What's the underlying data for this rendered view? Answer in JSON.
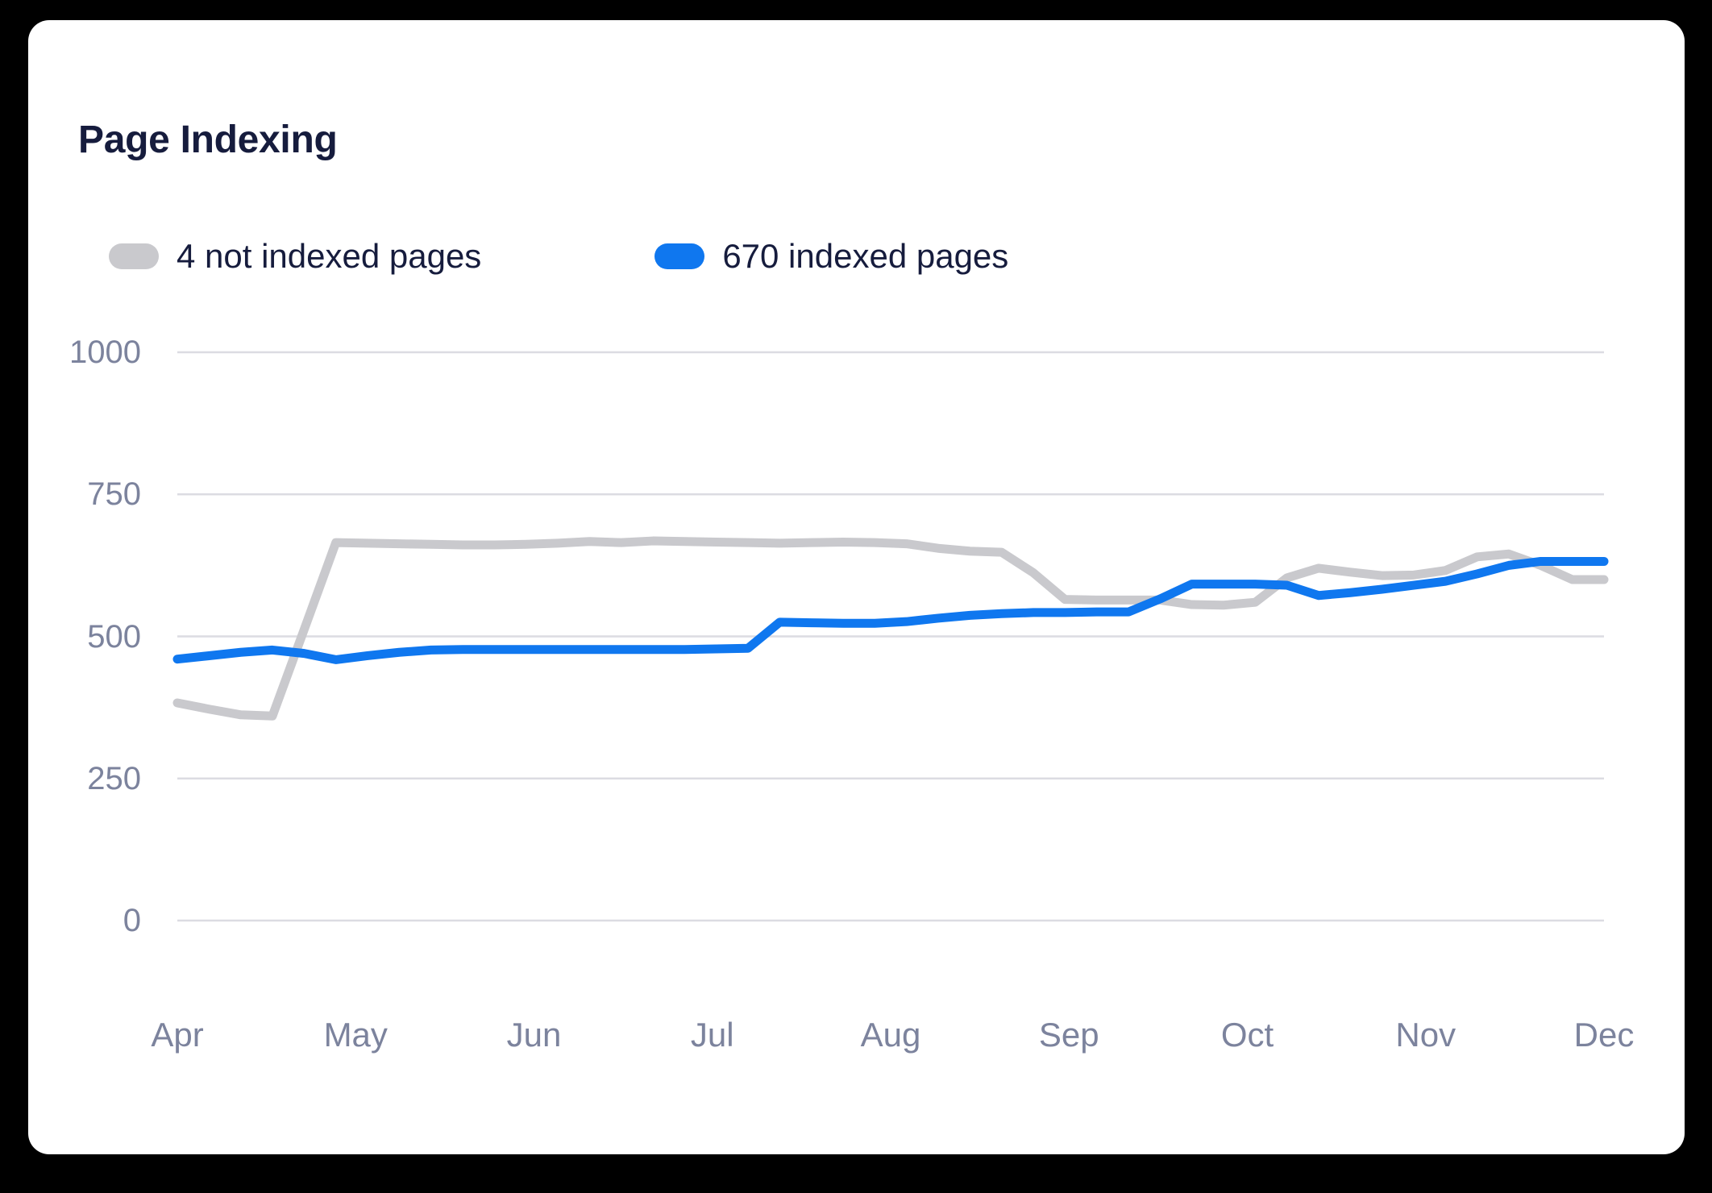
{
  "card": {
    "background": "#ffffff",
    "page_background": "#000000"
  },
  "header": {
    "title": "Page Indexing"
  },
  "legend": [
    {
      "label": "4 not indexed pages",
      "color": "#c9c9cd",
      "series": "not_indexed"
    },
    {
      "label": "670 indexed pages",
      "color": "#0f77ef",
      "series": "indexed"
    }
  ],
  "chart_data": {
    "type": "line",
    "title": "Page Indexing",
    "xlabel": "",
    "ylabel": "",
    "ylim": [
      0,
      1000
    ],
    "yticks": [
      0,
      250,
      500,
      750,
      1000
    ],
    "ytick_labels": [
      "0",
      "250",
      "500",
      "750",
      "1000"
    ],
    "grid": true,
    "grid_color": "#dcdce2",
    "legend_position": "top-left",
    "categories": [
      "Apr",
      "May",
      "Jun",
      "Jul",
      "Aug",
      "Sep",
      "Oct",
      "Nov",
      "Dec"
    ],
    "xticks": [
      "Apr",
      "May",
      "Jun",
      "Jul",
      "Aug",
      "Sep",
      "Oct",
      "Nov",
      "Dec"
    ],
    "x": [
      "Apr 1",
      "Apr 6",
      "Apr 11",
      "Apr 13",
      "Apr 18",
      "Apr 24",
      "May 1",
      "May 8",
      "May 15",
      "May 22",
      "May 29",
      "Jun 5",
      "Jun 12",
      "Jun 19",
      "Jun 26",
      "Jul 3",
      "Jul 10",
      "Jul 17",
      "Jul 22",
      "Jul 25",
      "Aug 1",
      "Aug 8",
      "Aug 15",
      "Aug 20",
      "Aug 24",
      "Aug 28",
      "Sep 2",
      "Sep 8",
      "Sep 14",
      "Sep 20",
      "Sep 24",
      "Sep 27",
      "Oct 2",
      "Oct 8",
      "Oct 14",
      "Oct 20",
      "Oct 26",
      "Nov 2",
      "Nov 8",
      "Nov 14",
      "Nov 20",
      "Nov 25",
      "Nov 29",
      "Dec 5",
      "Dec 12",
      "Dec 20"
    ],
    "series": [
      {
        "name": "4 not indexed pages",
        "color": "#c9c9cd",
        "values": [
          383,
          372,
          362,
          360,
          512,
          665,
          664,
          663,
          662,
          661,
          661,
          662,
          664,
          667,
          665,
          668,
          667,
          666,
          665,
          664,
          665,
          666,
          665,
          663,
          655,
          650,
          648,
          612,
          565,
          564,
          564,
          564,
          556,
          555,
          560,
          603,
          620,
          613,
          607,
          608,
          616,
          640,
          645,
          625,
          600,
          600
        ]
      },
      {
        "name": "670 indexed pages",
        "color": "#0f77ef",
        "values": [
          460,
          466,
          472,
          476,
          470,
          459,
          466,
          472,
          476,
          477,
          477,
          477,
          477,
          477,
          477,
          477,
          477,
          478,
          479,
          525,
          524,
          523,
          523,
          526,
          532,
          537,
          540,
          542,
          542,
          543,
          543,
          566,
          592,
          592,
          592,
          590,
          572,
          577,
          583,
          590,
          597,
          610,
          625,
          632,
          632,
          632
        ]
      }
    ]
  }
}
